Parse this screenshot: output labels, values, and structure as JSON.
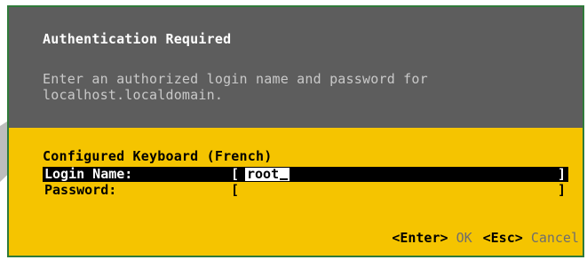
{
  "dialog": {
    "title": "Authentication Required",
    "message_line1": "Enter an authorized login name and password for",
    "message_line2": "localhost.localdomain.",
    "keyboard": "Configured Keyboard (French)"
  },
  "form": {
    "login_label": "Login Name:",
    "login_value": "root",
    "password_label": "Password:",
    "bracket_open": "[",
    "bracket_close": "]"
  },
  "footer": {
    "enter_key": "<Enter>",
    "enter_action": "OK",
    "esc_key": "<Esc>",
    "esc_action": "Cancel"
  },
  "colors": {
    "header_bg": "#5d5d5d",
    "body_bg": "#f5c400",
    "border": "#2f7a3a",
    "active_row": "#000000"
  }
}
